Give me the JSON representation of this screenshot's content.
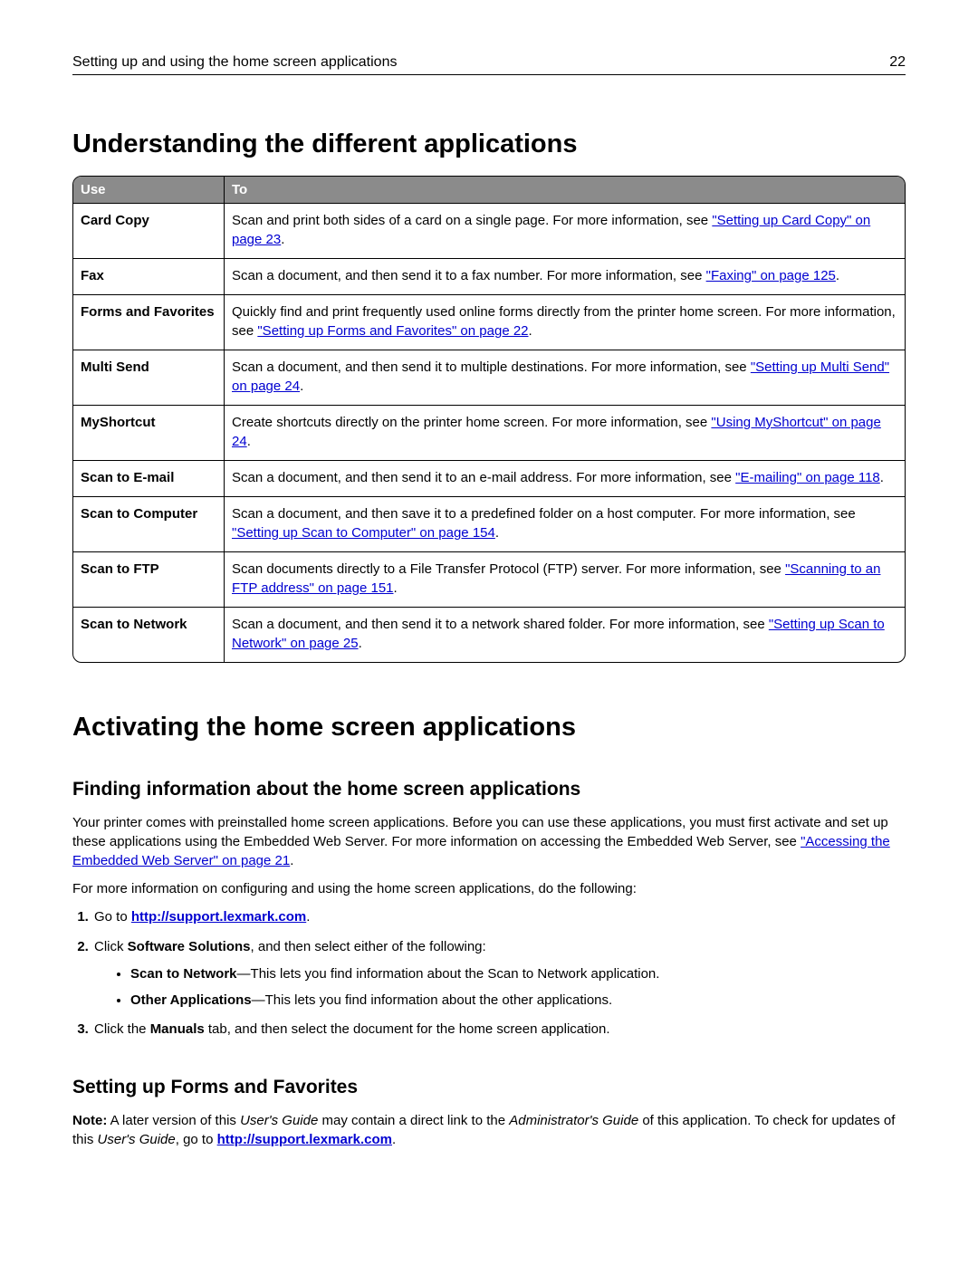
{
  "header": {
    "title": "Setting up and using the home screen applications",
    "page": "22"
  },
  "h1a": "Understanding the different applications",
  "table": {
    "col1": "Use",
    "col2": "To",
    "rows": [
      {
        "use": "Card Copy",
        "pre": "Scan and print both sides of a card on a single page. For more information, see ",
        "link": "\"Setting up Card Copy\" on page 23",
        "post": "."
      },
      {
        "use": "Fax",
        "pre": "Scan a document, and then send it to a fax number. For more information, see ",
        "link": "\"Faxing\" on page 125",
        "post": "."
      },
      {
        "use": "Forms and Favorites",
        "pre": "Quickly find and print frequently used online forms directly from the printer home screen. For more information, see ",
        "link": "\"Setting up Forms and Favorites\" on page 22",
        "post": "."
      },
      {
        "use": "Multi Send",
        "pre": "Scan a document, and then send it to multiple destinations. For more information, see ",
        "link": "\"Setting up Multi Send\" on page 24",
        "post": "."
      },
      {
        "use": "MyShortcut",
        "pre": "Create shortcuts directly on the printer home screen. For more information, see ",
        "link": "\"Using MyShortcut\" on page 24",
        "post": "."
      },
      {
        "use": "Scan to E-mail",
        "pre": "Scan a document, and then send it to an e-mail address. For more information, see ",
        "link": "\"E-mailing\" on page 118",
        "post": "."
      },
      {
        "use": "Scan to Computer",
        "pre": "Scan a document, and then save it to a predefined folder on a host computer. For more information, see ",
        "link": "\"Setting up Scan to Computer\" on page 154",
        "post": "."
      },
      {
        "use": "Scan to FTP",
        "pre": "Scan documents directly to a File Transfer Protocol (FTP) server. For more information, see ",
        "link": "\"Scanning to an FTP address\" on page 151",
        "post": "."
      },
      {
        "use": "Scan to Network",
        "pre": "Scan a document, and then send it to a network shared folder. For more information, see ",
        "link": "\"Setting up Scan to Network\" on page 25",
        "post": "."
      }
    ]
  },
  "h1b": "Activating the home screen applications",
  "sec1": {
    "h2": "Finding information about the home screen applications",
    "p1a": "Your printer comes with preinstalled home screen applications. Before you can use these applications, you must first activate and set up these applications using the Embedded Web Server. For more information on accessing the Embedded Web Server, see ",
    "p1link": "\"Accessing the Embedded Web Server\" on page 21",
    "p1b": ".",
    "p2": "For more information on configuring and using the home screen applications, do the following:",
    "step1a": "Go to ",
    "step1link": "http://support.lexmark.com",
    "step1b": ".",
    "step2a": "Click ",
    "step2bold": "Software Solutions",
    "step2b": ", and then select either of the following:",
    "bullet1bold": "Scan to Network",
    "bullet1rest": "—This lets you find information about the Scan to Network application.",
    "bullet2bold": "Other Applications",
    "bullet2rest": "—This lets you find information about the other applications.",
    "step3a": "Click the ",
    "step3bold": "Manuals",
    "step3b": " tab, and then select the document for the home screen application."
  },
  "sec2": {
    "h2": "Setting up Forms and Favorites",
    "noteLabel": "Note:",
    "t1": " A later version of this ",
    "i1": "User's Guide",
    "t2": " may contain a direct link to the ",
    "i2": "Administrator's Guide",
    "t3": " of this application. To check for updates of this ",
    "i3": "User's Guide",
    "t4": ", go to ",
    "link": "http://support.lexmark.com",
    "t5": "."
  }
}
